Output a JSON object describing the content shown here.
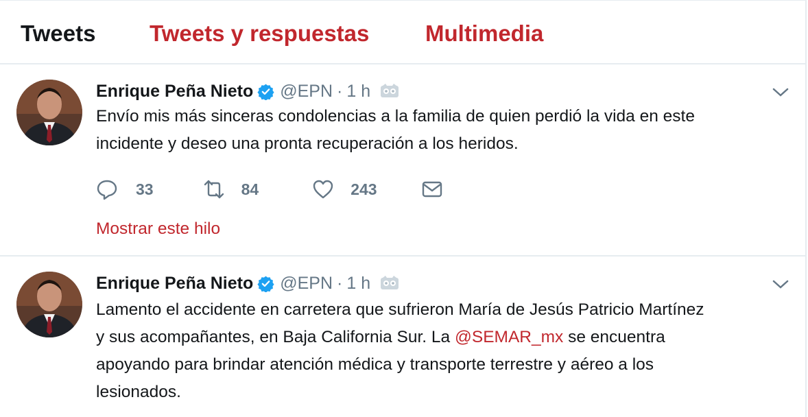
{
  "tabs": [
    {
      "label": "Tweets",
      "active": true
    },
    {
      "label": "Tweets y respuestas",
      "active": false
    },
    {
      "label": "Multimedia",
      "active": false
    }
  ],
  "colors": {
    "accent": "#c1272d",
    "secondary": "#657786",
    "verified": "#1da1f2"
  },
  "tweets": [
    {
      "author_name": "Enrique Peña Nieto",
      "handle": "@EPN",
      "separator": "·",
      "time": "1 h",
      "text_lines": [
        "Envío mis más sinceras condolencias a la familia de quien perdió la vida en este",
        "incidente y deseo una pronta recuperación a los heridos."
      ],
      "replies": "33",
      "retweets": "84",
      "likes": "243",
      "thread_link": "Mostrar este hilo"
    },
    {
      "author_name": "Enrique Peña Nieto",
      "handle": "@EPN",
      "separator": "·",
      "time": "1 h",
      "line1": "Lamento el accidente en carretera que sufrieron María de Jesús Patricio Martínez",
      "line2_before": "y sus acompañantes, en Baja California Sur. La ",
      "mention": "@SEMAR_mx",
      "line2_after": " se encuentra",
      "line3": "apoyando para brindar atención médica y transporte terrestre y aéreo a los",
      "line4": "lesionados."
    }
  ],
  "icons": {
    "verified": "verified-badge-icon",
    "translate": "translate-owl-icon",
    "caret": "chevron-down-icon",
    "reply": "reply-icon",
    "retweet": "retweet-icon",
    "like": "heart-icon",
    "dm": "envelope-icon"
  }
}
